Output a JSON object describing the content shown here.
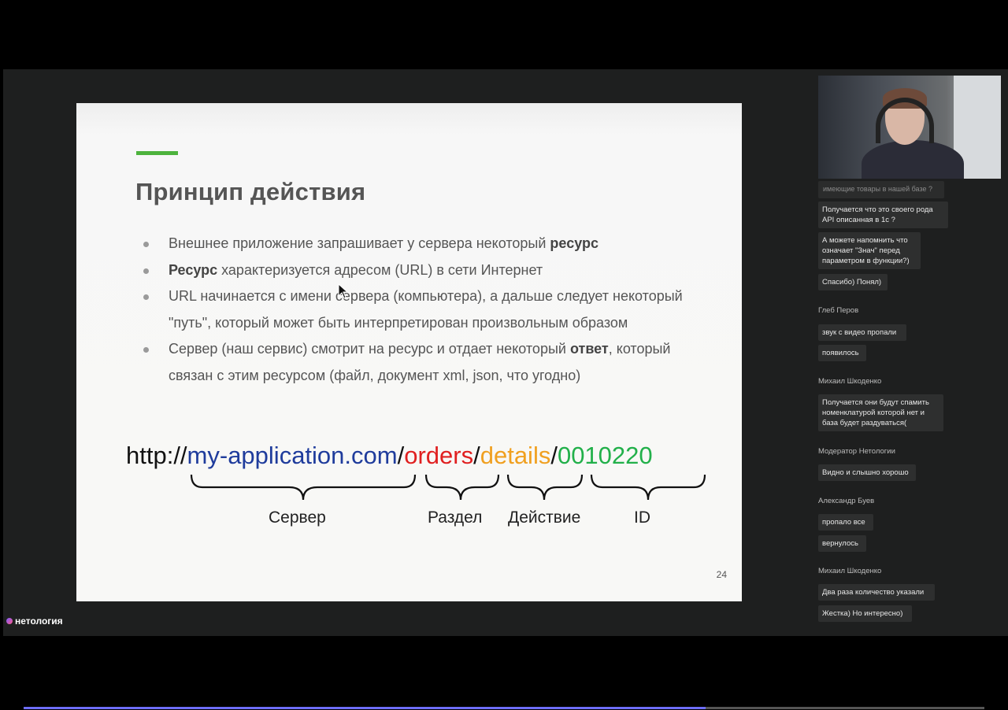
{
  "slide": {
    "accent_color": "#4db33d",
    "title": "Принцип действия",
    "bullets": [
      {
        "pre": "Внешнее приложение запрашивает у сервера некоторый ",
        "bold": "ресурс",
        "post": ""
      },
      {
        "pre": "",
        "bold": "Ресурс",
        "post": " характеризуется адресом (URL) в сети Интернет"
      },
      {
        "pre": "URL начинается с имени сервера (компьютера), а дальше следует некоторый \"путь\", который может быть интерпретирован произвольным образом",
        "bold": "",
        "post": ""
      },
      {
        "pre": "Сервер (наш сервис) смотрит на ресурс и отдает некоторый ",
        "bold": "ответ",
        "post": ", который связан с этим ресурсом (файл, документ xml, json, что угодно)"
      }
    ],
    "url": {
      "scheme": "http://",
      "host": "my-application.com",
      "sep1": "/",
      "section": "orders",
      "sep2": "/",
      "action": "details",
      "sep3": "/",
      "id": "0010220",
      "colors": {
        "scheme": "#111111",
        "host": "#1f3c9c",
        "section": "#e02020",
        "action": "#f0a020",
        "id": "#22b04a",
        "sep": "#111111"
      }
    },
    "labels": {
      "server": "Сервер",
      "section": "Раздел",
      "action": "Действие",
      "id": "ID"
    },
    "page_number": "24"
  },
  "brand": "нетология",
  "chat": {
    "cut_text": "имеющие товары в нашей базе ?",
    "messages": [
      {
        "text": "Получается что это своего рода API описанная в 1с ?"
      },
      {
        "text": "А можете напомнить что означает \"Знач\" перед параметром в функции?)"
      },
      {
        "text": "Спасибо) Понял)"
      },
      {
        "author": "Глеб Перов"
      },
      {
        "text": "звук с видео пропали"
      },
      {
        "text": "появилось"
      },
      {
        "author": "Михаил Шкоденко"
      },
      {
        "text": "Получается они будут спамить номенклатурой которой нет и база будет раздуваться("
      },
      {
        "author": "Модератор Нетологии"
      },
      {
        "text": "Видно и слышно хорошо"
      },
      {
        "author": "Александр Буев"
      },
      {
        "text": "пропало все"
      },
      {
        "text": "вернулось"
      },
      {
        "author": "Михаил Шкоденко"
      },
      {
        "text": "Два раза количество указали"
      },
      {
        "text": "Жестка) Но интересно)"
      }
    ]
  },
  "progress": {
    "fraction": 0.71
  }
}
